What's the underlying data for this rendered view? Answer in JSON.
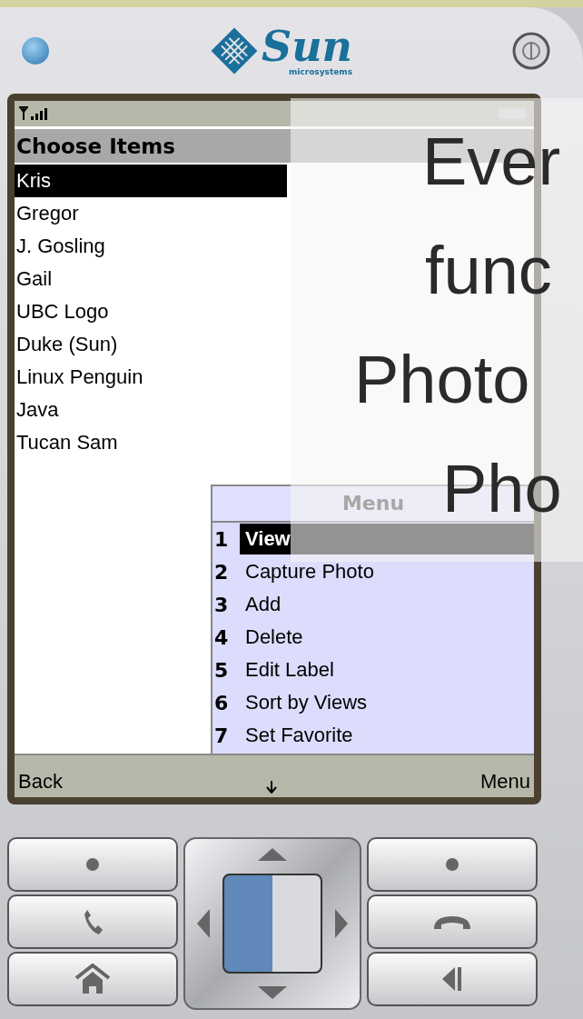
{
  "logo": {
    "name": "Sun",
    "tagline": "microsystems"
  },
  "screen": {
    "title": "Choose Items",
    "items": [
      {
        "label": "Kris",
        "selected": true
      },
      {
        "label": "Gregor",
        "selected": false
      },
      {
        "label": "J. Gosling",
        "selected": false
      },
      {
        "label": "Gail",
        "selected": false
      },
      {
        "label": "UBC Logo",
        "selected": false
      },
      {
        "label": "Duke (Sun)",
        "selected": false
      },
      {
        "label": "Linux Penguin",
        "selected": false
      },
      {
        "label": "Java",
        "selected": false
      },
      {
        "label": "Tucan Sam",
        "selected": false
      }
    ],
    "menu": {
      "title": "Menu",
      "items": [
        {
          "number": "1",
          "label": "View",
          "selected": true
        },
        {
          "number": "2",
          "label": "Capture Photo",
          "selected": false
        },
        {
          "number": "3",
          "label": "Add",
          "selected": false
        },
        {
          "number": "4",
          "label": "Delete",
          "selected": false
        },
        {
          "number": "5",
          "label": "Edit Label",
          "selected": false
        },
        {
          "number": "6",
          "label": "Sort by Views",
          "selected": false
        },
        {
          "number": "7",
          "label": "Set Favorite",
          "selected": false
        }
      ]
    },
    "softkeys": {
      "left": "Back",
      "right": "Menu"
    }
  },
  "overlay": {
    "lines": [
      "Ever",
      "func",
      "Photo",
      "Pho"
    ]
  }
}
